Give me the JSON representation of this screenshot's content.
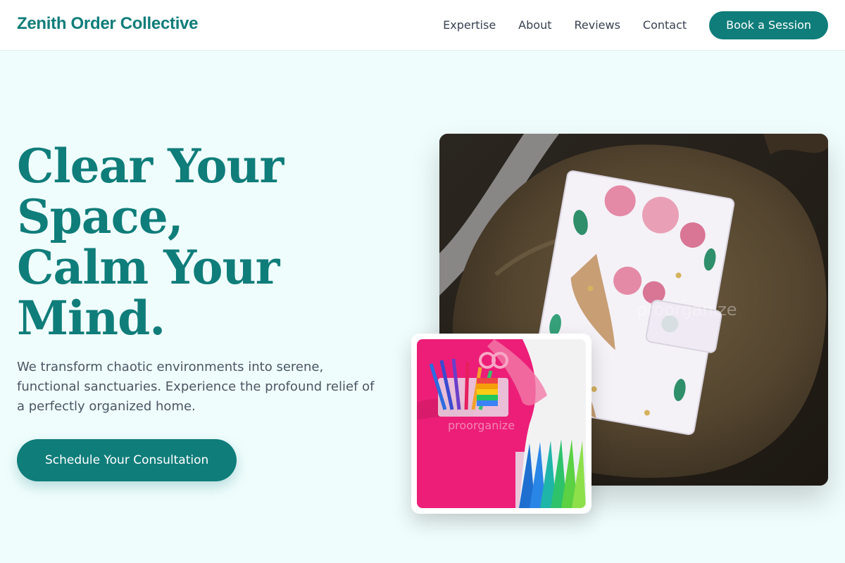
{
  "nav": {
    "brand": "Zenith Order Collective",
    "links": [
      "Expertise",
      "About",
      "Reviews",
      "Contact"
    ],
    "cta": "Book a Session"
  },
  "hero": {
    "title_lines": [
      "Clear Your",
      "Space,",
      "Calm Your",
      "Mind."
    ],
    "subtitle": "We transform chaotic environments into serene, functional sanctuaries. Experience the profound relief of a perfectly organized home.",
    "cta": "Schedule Your Consultation"
  },
  "images": {
    "main_watermark": "proorganize",
    "inset_watermark": "proorganize"
  },
  "colors": {
    "accent": "#0f7d7a",
    "background": "#f0fdfd",
    "text_muted": "#4b5563"
  }
}
